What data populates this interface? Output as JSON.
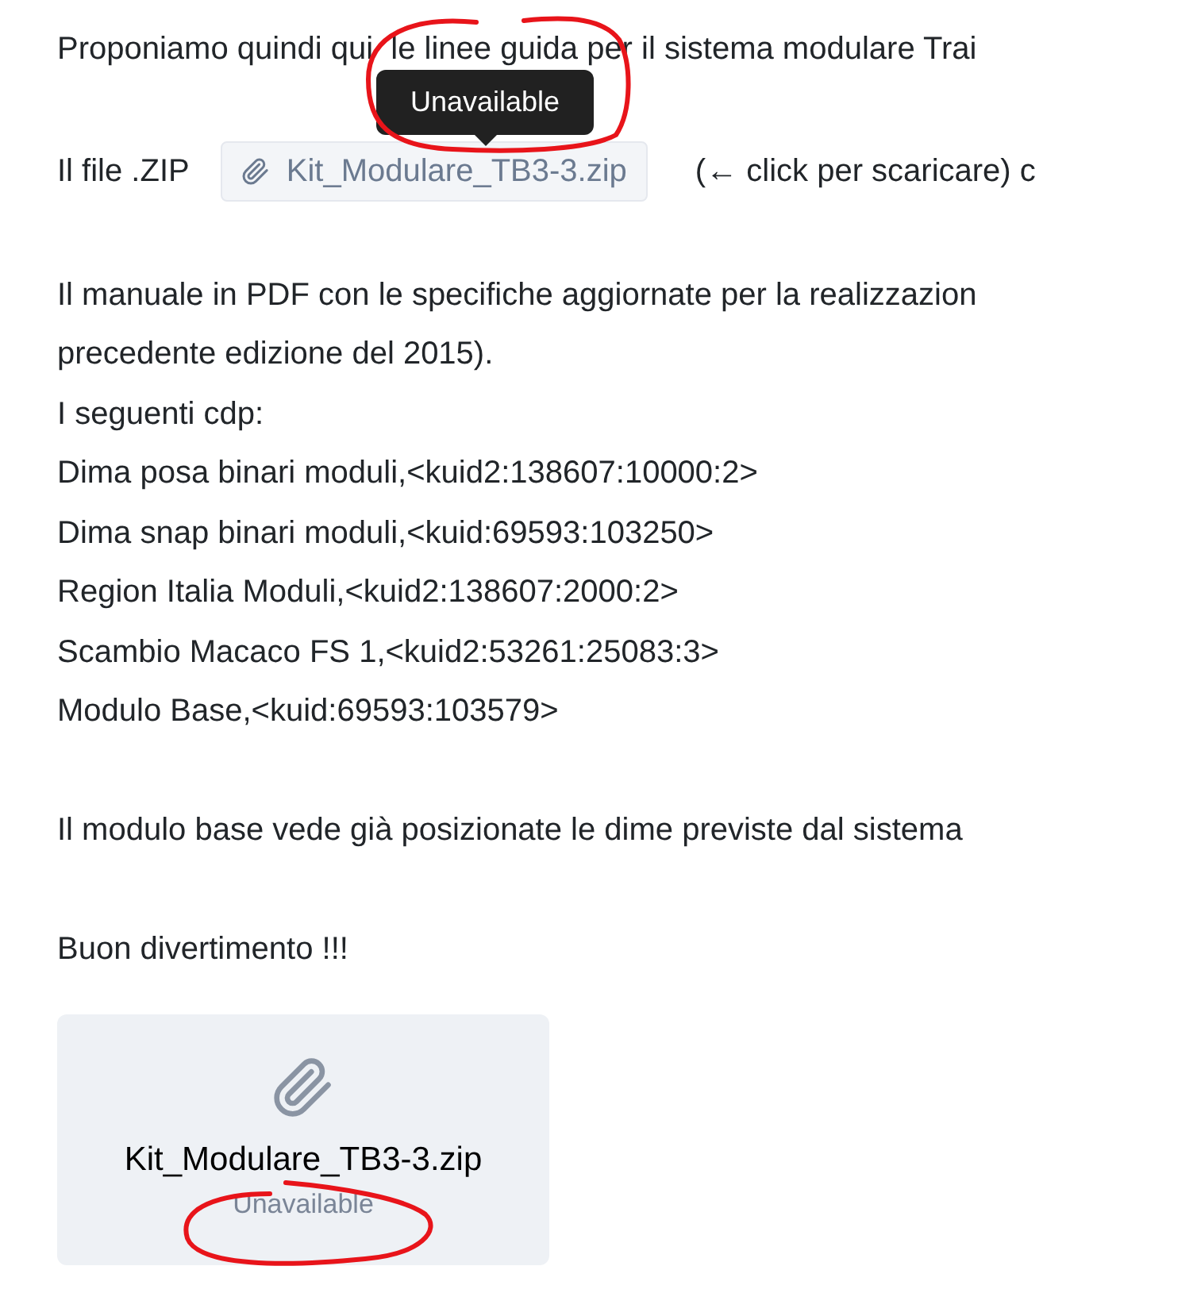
{
  "intro": "Proponiamo quindi qui  le linee guida per il sistema modulare Trai",
  "tooltip": "Unavailable",
  "file_line": {
    "label": "Il file .ZIP",
    "chip": "Kit_Modulare_TB3-3.zip",
    "after": "(← click per scaricare) c"
  },
  "lines_a": [
    "Il manuale in PDF con le specifiche aggiornate per la realizzazion",
    "precedente edizione del 2015).",
    "I seguenti cdp:",
    "Dima posa binari moduli,<kuid2:138607:10000:2>",
    "Dima snap binari moduli,<kuid:69593:103250>",
    "Region Italia Moduli,<kuid2:138607:2000:2>",
    "Scambio Macaco FS 1,<kuid2:53261:25083:3>",
    "Modulo Base,<kuid:69593:103579>"
  ],
  "lines_b": [
    "Il modulo base vede già posizionate le dime previste dal sistema"
  ],
  "closing": "Buon divertimento !!!",
  "attachment": {
    "name": "Kit_Modulare_TB3-3.zip",
    "status": "Unavailable"
  }
}
